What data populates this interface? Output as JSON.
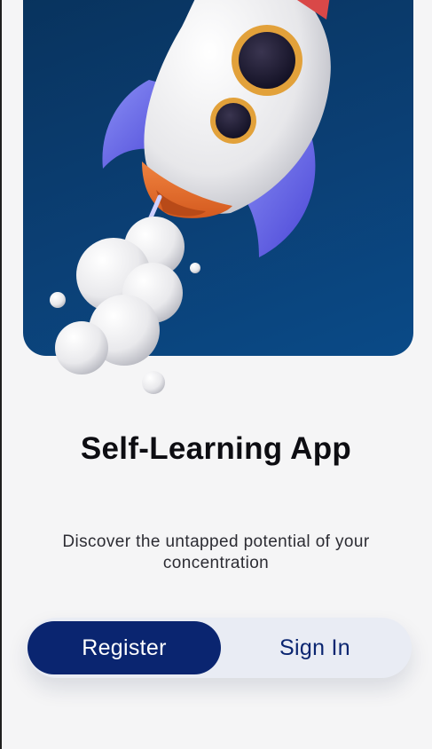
{
  "hero": {
    "illustration": "rocket-launch-illustration"
  },
  "title": "Self-Learning App",
  "subtitle": "Discover the untapped potential of your concentration",
  "auth": {
    "register_label": "Register",
    "signin_label": "Sign In",
    "selected": "Register"
  },
  "colors": {
    "hero_background": "#0b3f74",
    "accent": "#0a2570",
    "page_background": "#f5f5f6",
    "toggle_background": "#e9ecf4"
  }
}
